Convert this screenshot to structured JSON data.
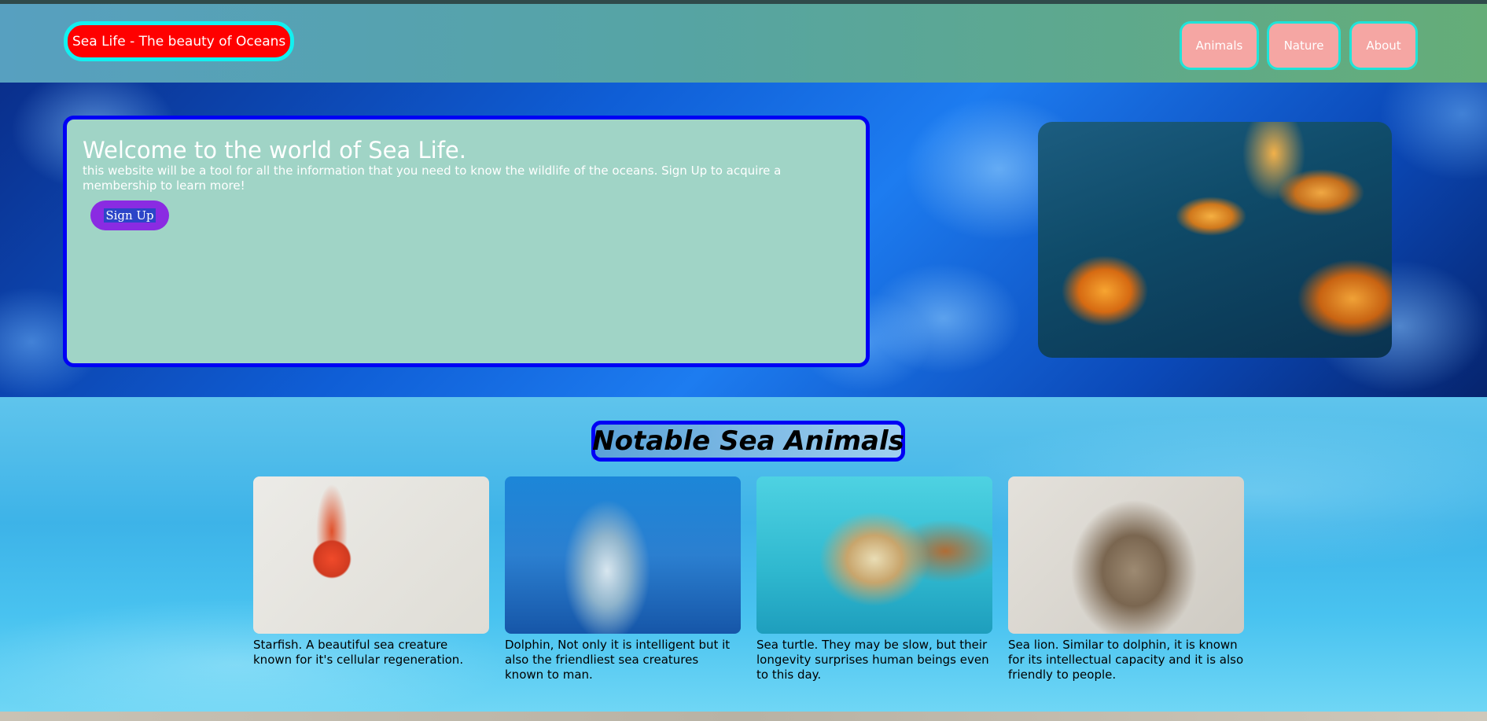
{
  "header": {
    "brand": "Sea Life - The beauty of Oceans",
    "nav": [
      "Animals",
      "Nature",
      "About"
    ]
  },
  "hero": {
    "title": "Welcome to the world of Sea Life.",
    "text": "this website will be a tool for all the information that you need to know the wildlife of the oceans. Sign Up to acquire a membership to learn more!",
    "signup_label": "Sign Up"
  },
  "animals": {
    "heading": "Notable Sea Animals",
    "cards": [
      {
        "name": "starfish",
        "caption": "Starfish. A beautiful sea creature known for it's cellular regeneration."
      },
      {
        "name": "dolphin",
        "caption": "Dolphin, Not only it is intelligent but it also the friendliest sea creatures known to man."
      },
      {
        "name": "sea-turtle",
        "caption": "Sea turtle. They may be slow, but their longevity surprises human beings even to this day."
      },
      {
        "name": "sea-lion",
        "caption": "Sea lion. Similar to dolphin, it is known for its intellectual capacity and it is also friendly to people."
      }
    ]
  },
  "colors": {
    "brand_bg": "#ff0000",
    "brand_border": "#13f0f0",
    "nav_bg": "#f5a6a3",
    "card_bg": "#a0d4c6",
    "card_border": "#0000f5",
    "signup_bg": "#8a2be2"
  }
}
